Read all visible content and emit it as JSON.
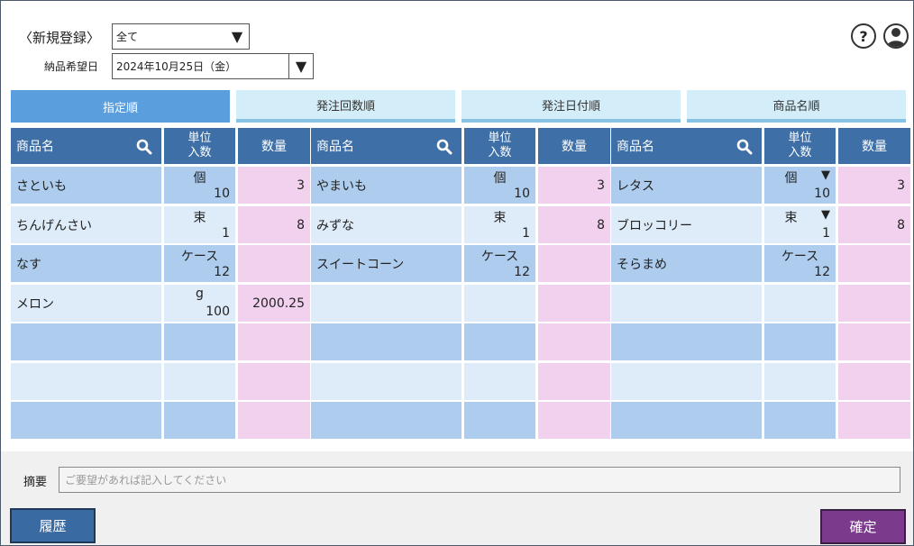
{
  "header": {
    "new_register_label": "〈新規登録〉",
    "filter_select_value": "全て",
    "delivery_label": "納品希望日",
    "delivery_date_value": "2024年10月25日（金）",
    "help_label": "?"
  },
  "tabs": [
    {
      "label": "指定順",
      "active": true
    },
    {
      "label": "発注回数順",
      "active": false
    },
    {
      "label": "発注日付順",
      "active": false
    },
    {
      "label": "商品名順",
      "active": false
    }
  ],
  "table": {
    "columns": {
      "name": "商品名",
      "unit_line1": "単位",
      "unit_line2": "入数",
      "qty": "数量"
    },
    "groups": [
      {
        "rows": [
          {
            "name": "さといも",
            "unit": "個",
            "num": "10",
            "qty": "3",
            "dropdown": false
          },
          {
            "name": "ちんげんさい",
            "unit": "束",
            "num": "1",
            "qty": "8",
            "dropdown": false
          },
          {
            "name": "なす",
            "unit": "ケース",
            "num": "12",
            "qty": "",
            "dropdown": false
          },
          {
            "name": "メロン",
            "unit": "g",
            "num": "100",
            "qty": "2000.25",
            "dropdown": false
          }
        ]
      },
      {
        "rows": [
          {
            "name": "やまいも",
            "unit": "個",
            "num": "10",
            "qty": "3",
            "dropdown": false
          },
          {
            "name": "みずな",
            "unit": "束",
            "num": "1",
            "qty": "8",
            "dropdown": false
          },
          {
            "name": "スイートコーン",
            "unit": "ケース",
            "num": "12",
            "qty": "",
            "dropdown": false
          }
        ]
      },
      {
        "rows": [
          {
            "name": "レタス",
            "unit": "個",
            "num": "10",
            "qty": "3",
            "dropdown": true
          },
          {
            "name": "ブロッコリー",
            "unit": "束",
            "num": "1",
            "qty": "8",
            "dropdown": true
          },
          {
            "name": "そらまめ",
            "unit": "ケース",
            "num": "12",
            "qty": "",
            "dropdown": false
          }
        ]
      }
    ],
    "total_rows": 7
  },
  "memo": {
    "label": "摘要",
    "placeholder": "ご要望があれば記入してください"
  },
  "buttons": {
    "history": "履歴",
    "confirm": "確定"
  },
  "colors": {
    "header_bg": "#3e6fa6",
    "row_dark": "#aecdee",
    "row_light": "#deebf8",
    "qty_bg": "#f2d1ef",
    "tab_active": "#5a9ede",
    "tab_inactive": "#d3eef9",
    "history_btn": "#3a6aa2",
    "confirm_btn": "#7b3a8c"
  }
}
